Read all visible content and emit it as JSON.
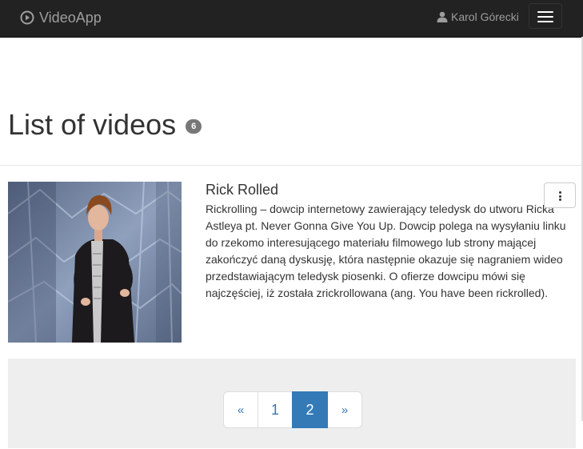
{
  "navbar": {
    "brand_label": "VideoApp",
    "brand_icon": "play-circle-icon",
    "user_name": "Karol Górecki",
    "user_icon": "user-icon",
    "menu_icon": "hamburger-menu-icon"
  },
  "header": {
    "title": "List of videos",
    "count": "6"
  },
  "video": {
    "title": "Rick Rolled",
    "description": "Rickrolling – dowcip internetowy zawierający teledysk do utworu Ricka Astleya pt. Never Gonna Give You Up. Dowcip polega na wysyłaniu linku do rzekomo interesującego materiału filmowego lub strony mającej zakończyć daną dyskusję, która następnie okazuje się nagraniem wideo przedstawiającym teledysk piosenki. O ofierze dowcipu mówi się najczęściej, iż została zrickrollowana (ang. You have been rickrolled).",
    "menu_icon": "kebab-menu-icon"
  },
  "pagination": {
    "prev": "«",
    "pages": [
      "1",
      "2"
    ],
    "active_page": "2",
    "next": "»"
  },
  "colors": {
    "navbar_bg": "#222222",
    "navbar_text": "#9d9d9d",
    "accent": "#337ab7",
    "badge": "#777777",
    "well": "#eeeeee"
  }
}
